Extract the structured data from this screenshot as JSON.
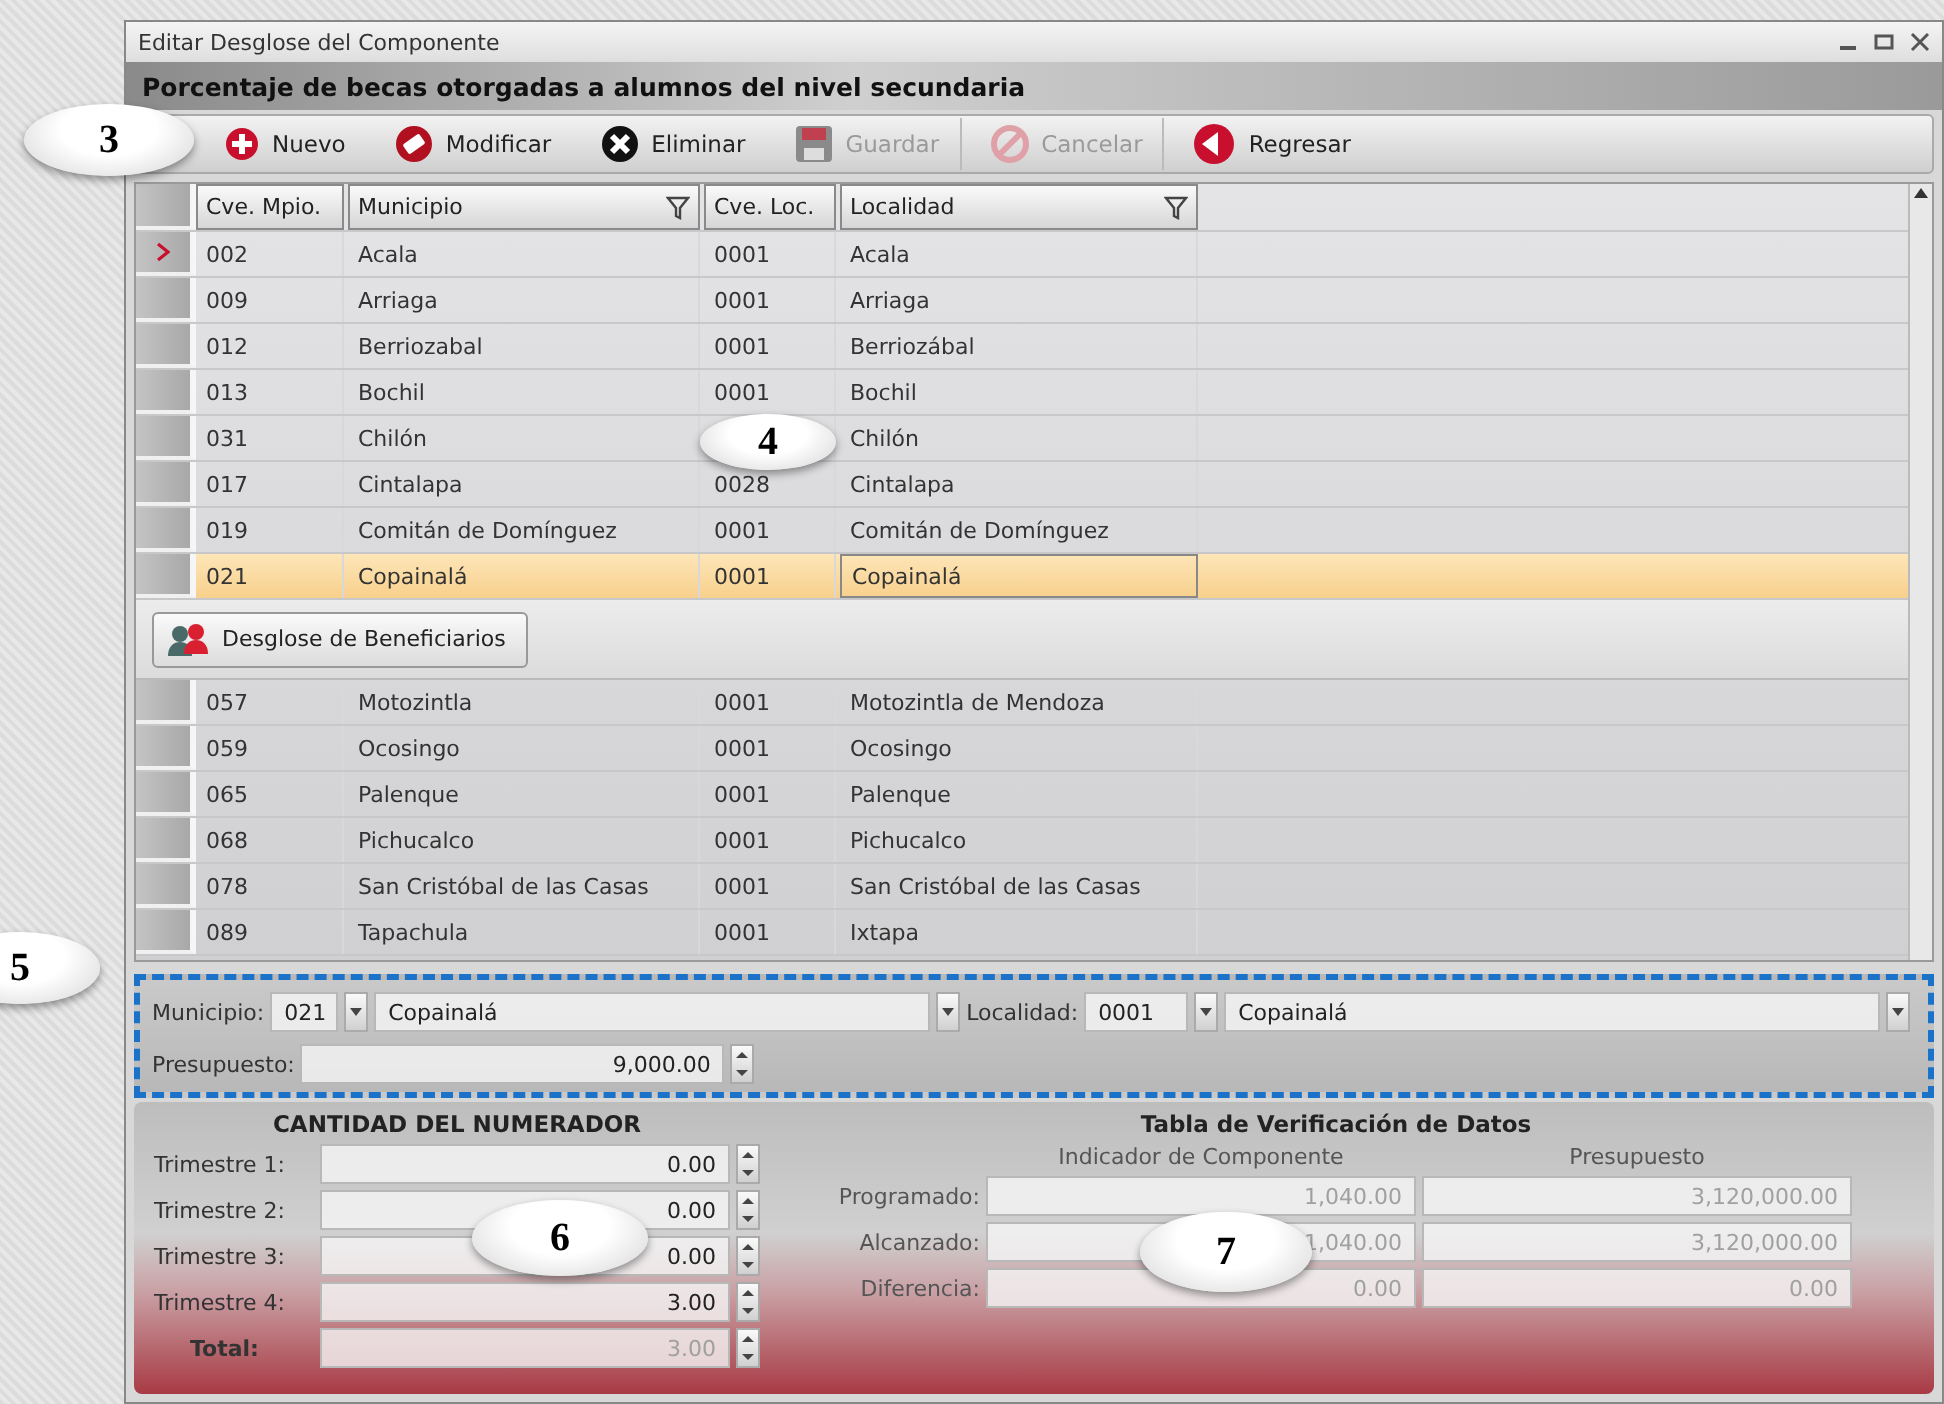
{
  "window": {
    "title": "Editar Desglose del Componente"
  },
  "header": "Porcentaje  de becas otorgadas  a alumnos  del nivel secundaria",
  "toolbar": [
    {
      "label": "Nuevo",
      "kind": "add",
      "disabled": false
    },
    {
      "label": "Modificar",
      "kind": "edit",
      "disabled": false
    },
    {
      "label": "Eliminar",
      "kind": "delete",
      "disabled": false
    },
    {
      "label": "Guardar",
      "kind": "save",
      "disabled": true
    },
    {
      "label": "Cancelar",
      "kind": "cancel",
      "disabled": true
    },
    {
      "label": "Regresar",
      "kind": "back",
      "disabled": false
    }
  ],
  "grid": {
    "columns": [
      {
        "label": "Cve. Mpio.",
        "filter": false
      },
      {
        "label": "Municipio",
        "filter": true
      },
      {
        "label": "Cve. Loc.",
        "filter": false
      },
      {
        "label": "Localidad",
        "filter": true
      }
    ],
    "rows": [
      {
        "cells": [
          "002",
          "Acala",
          "0001",
          "Acala"
        ],
        "current": true,
        "selected": false
      },
      {
        "cells": [
          "009",
          "Arriaga",
          "0001",
          "Arriaga"
        ],
        "current": false,
        "selected": false
      },
      {
        "cells": [
          "012",
          "Berriozabal",
          "0001",
          "Berriozábal"
        ],
        "current": false,
        "selected": false
      },
      {
        "cells": [
          "013",
          "Bochil",
          "0001",
          "Bochil"
        ],
        "current": false,
        "selected": false
      },
      {
        "cells": [
          "031",
          "Chilón",
          null,
          "Chilón"
        ],
        "current": false,
        "selected": false
      },
      {
        "cells": [
          "017",
          "Cintalapa",
          "0028",
          "Cintalapa"
        ],
        "current": false,
        "selected": false
      },
      {
        "cells": [
          "019",
          "Comitán de Domínguez",
          "0001",
          "Comitán de Domínguez"
        ],
        "current": false,
        "selected": false
      },
      {
        "cells": [
          "021",
          "Copainalá",
          "0001",
          "Copainalá"
        ],
        "current": false,
        "selected": true,
        "detail": "Desglose de Beneficiarios"
      },
      {
        "cells": [
          "057",
          "Motozintla",
          "0001",
          "Motozintla de Mendoza"
        ],
        "current": false,
        "selected": false
      },
      {
        "cells": [
          "059",
          "Ocosingo",
          "0001",
          "Ocosingo"
        ],
        "current": false,
        "selected": false
      },
      {
        "cells": [
          "065",
          "Palenque",
          "0001",
          "Palenque"
        ],
        "current": false,
        "selected": false
      },
      {
        "cells": [
          "068",
          "Pichucalco",
          "0001",
          "Pichucalco"
        ],
        "current": false,
        "selected": false
      },
      {
        "cells": [
          "078",
          "San Cristóbal de las Casas",
          "0001",
          "San Cristóbal de las Casas"
        ],
        "current": false,
        "selected": false
      },
      {
        "cells": [
          "089",
          "Tapachula",
          "0001",
          "Ixtapa"
        ],
        "current": false,
        "selected": false
      }
    ]
  },
  "form": {
    "municipio": {
      "label": "Municipio:",
      "code": "021",
      "name": "Copainalá"
    },
    "localidad": {
      "label": "Localidad:",
      "code": "0001",
      "name": "Copainalá"
    },
    "presupuesto": {
      "label": "Presupuesto:",
      "value": "9,000.00"
    }
  },
  "numerator": {
    "title": "CANTIDAD DEL NUMERADOR",
    "rows": [
      {
        "label": "Trimestre 1:",
        "value": "0.00"
      },
      {
        "label": "Trimestre 2:",
        "value": "0.00"
      },
      {
        "label": "Trimestre 3:",
        "value": "0.00"
      },
      {
        "label": "Trimestre 4:",
        "value": "3.00"
      }
    ],
    "total": {
      "label": "Total:",
      "value": "3.00",
      "disabled": true
    }
  },
  "verification": {
    "title": "Tabla de Verificación de Datos",
    "disabled": true,
    "columns": [
      "Indicador de Componente",
      "Presupuesto"
    ],
    "rows": [
      {
        "label": "Programado:",
        "values": [
          "1,040.00",
          "3,120,000.00"
        ]
      },
      {
        "label": "Alcanzado:",
        "values": [
          "1,040.00",
          "3,120,000.00"
        ]
      },
      {
        "label": "Diferencia:",
        "values": [
          "0.00",
          "0.00"
        ]
      }
    ]
  },
  "callouts": [
    "3",
    "4",
    "5",
    "6",
    "7"
  ]
}
